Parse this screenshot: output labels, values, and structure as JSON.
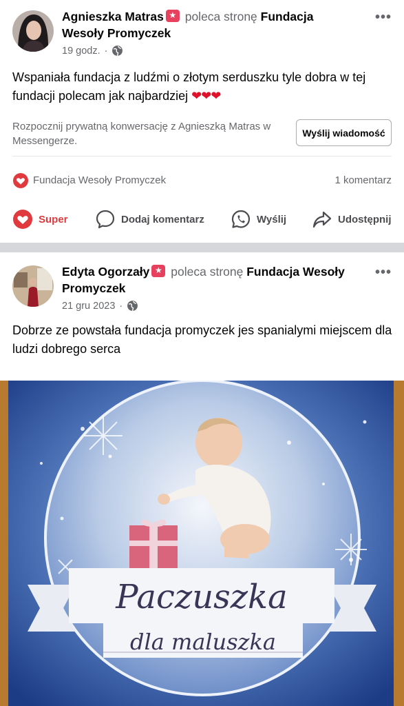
{
  "posts": [
    {
      "author": "Agnieszka Matras",
      "recommends_text": "poleca stronę",
      "page": "Fundacja Wesoły Promyczek",
      "time": "19 godz.",
      "text": "Wspaniała  fundacja z ludźmi o złotym serduszku tyle dobra w tej fundacji polecam jak najbardziej",
      "hearts": "❤❤❤",
      "messenger_prompt": "Rozpocznij prywatną konwersację z Agnieszką Matras w Messengerze.",
      "send_message_label": "Wyślij wiadomość",
      "reactions_by": "Fundacja Wesoły Promyczek",
      "comments_count": "1 komentarz",
      "actions": {
        "super": "Super",
        "comment": "Dodaj komentarz",
        "send": "Wyślij",
        "share": "Udostępnij"
      }
    },
    {
      "author": "Edyta Ogorzały",
      "recommends_text": "poleca stronę",
      "page": "Fundacja Wesoły Promyczek",
      "time": "21 gru 2023",
      "text": "Dobrze ze powstała fundacja promyczek jes spanialymi miejscem dla ludzi dobrego serca",
      "image": {
        "title_line1": "Paczuszka",
        "title_line2": "dla maluszka"
      }
    }
  ],
  "icons": {
    "badge": "recommend-badge-icon",
    "globe": "globe-icon",
    "more": "more-options-icon",
    "heart": "heart-reaction-icon",
    "comment": "comment-icon",
    "messenger": "whatsapp-send-icon",
    "share": "share-icon"
  },
  "colors": {
    "accent_red": "#e0393e",
    "badge_pink": "#e8415f",
    "muted": "#65676b",
    "divider": "#d5d7da"
  }
}
